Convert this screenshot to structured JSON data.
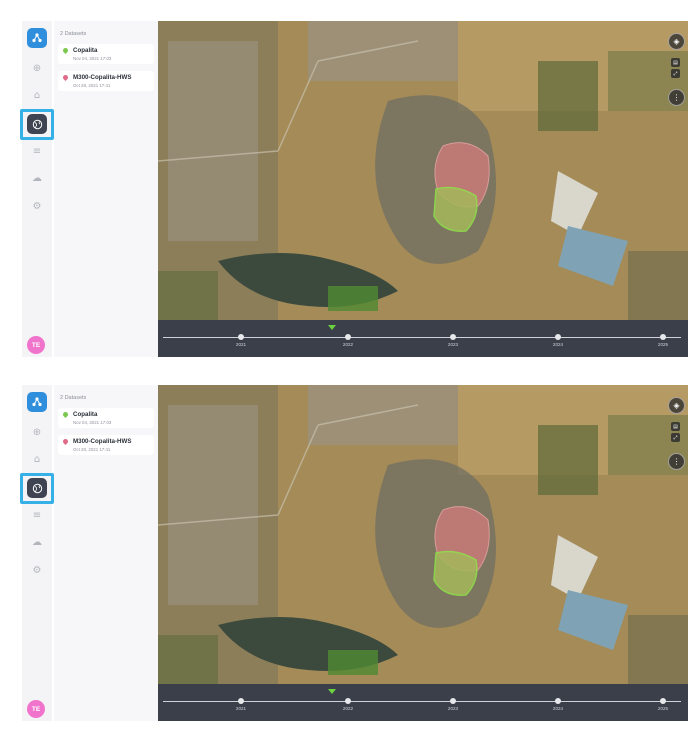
{
  "datasets_header": "2 Datasets",
  "datasets": [
    {
      "name": "Copalita",
      "date": "Nov 04, 2021 17:03",
      "pin_color": "#7cc84f"
    },
    {
      "name": "M300-Copalita-HWS",
      "date": "Oct 28, 2021 17:41",
      "pin_color": "#e06b86"
    }
  ],
  "user": {
    "initials": "TE"
  },
  "timeline": {
    "years": [
      "2021",
      "2022",
      "2023",
      "2024",
      "2025"
    ]
  },
  "icons": {
    "rail": [
      "logo-icon",
      "plus-circle-icon",
      "home-icon",
      "globe-icon",
      "list-icon",
      "cloud-upload-icon",
      "settings-icon"
    ],
    "map": [
      "compass-icon",
      "layers-icon",
      "fullscreen-icon",
      "more-vertical-icon"
    ]
  },
  "colors": {
    "accent": "#2f8fdc",
    "highlight": "#35b1e8",
    "selected_rail": "#3e4452",
    "timeline_bg": "#3b3f49"
  }
}
